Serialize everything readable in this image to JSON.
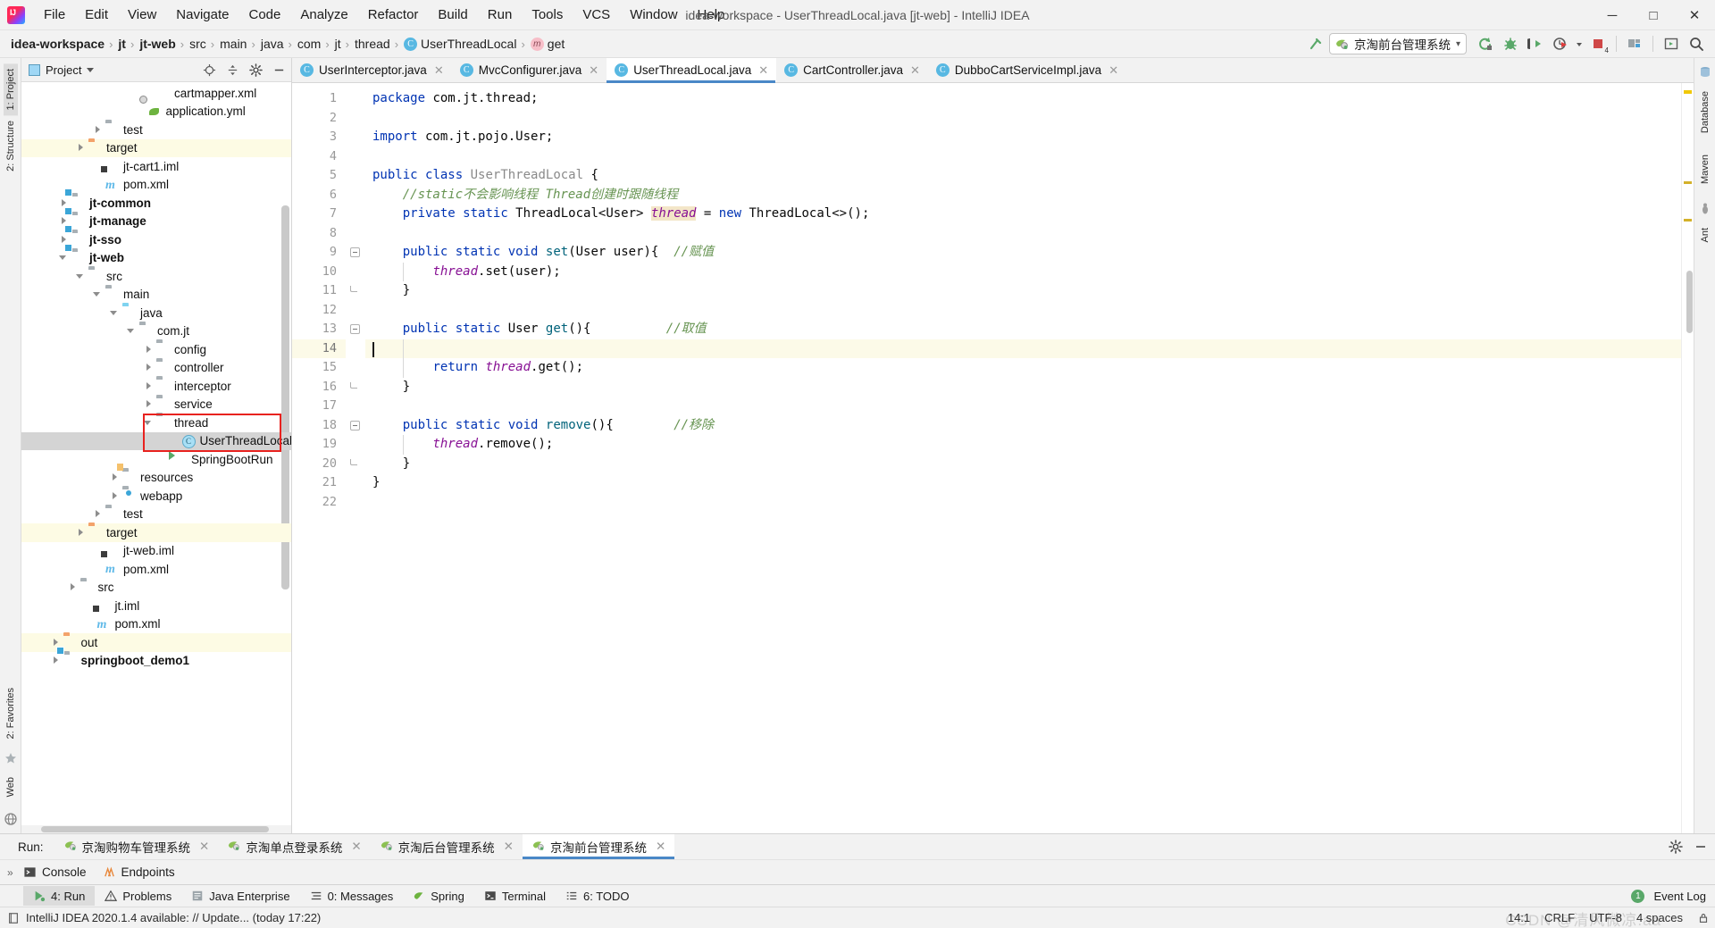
{
  "window": {
    "title": "idea-workspace - UserThreadLocal.java [jt-web] - IntelliJ IDEA",
    "minimize": "─",
    "maximize": "□",
    "close": "✕"
  },
  "menu": {
    "items": [
      "File",
      "Edit",
      "View",
      "Navigate",
      "Code",
      "Analyze",
      "Refactor",
      "Build",
      "Run",
      "Tools",
      "VCS",
      "Window",
      "Help"
    ]
  },
  "breadcrumb": {
    "items": [
      {
        "label": "idea-workspace",
        "bold": true,
        "icon": "none"
      },
      {
        "label": "jt",
        "bold": true,
        "icon": "none"
      },
      {
        "label": "jt-web",
        "bold": true,
        "icon": "none"
      },
      {
        "label": "src",
        "bold": false,
        "icon": "none"
      },
      {
        "label": "main",
        "bold": false,
        "icon": "none"
      },
      {
        "label": "java",
        "bold": false,
        "icon": "none"
      },
      {
        "label": "com",
        "bold": false,
        "icon": "none"
      },
      {
        "label": "jt",
        "bold": false,
        "icon": "none"
      },
      {
        "label": "thread",
        "bold": false,
        "icon": "none"
      },
      {
        "label": "UserThreadLocal",
        "bold": false,
        "icon": "class"
      },
      {
        "label": "get",
        "bold": false,
        "icon": "method"
      }
    ],
    "separator": "›"
  },
  "toolbar": {
    "run_config": "京淘前台管理系统",
    "run_config_caret": "▾",
    "buttons": [
      "rerun-icon",
      "debug-icon",
      "run-with-coverage-icon",
      "profiler-icon",
      "stop-icon",
      "project-structure-icon",
      "terminal-icon",
      "search-everywhere-icon"
    ],
    "stop_badge": "4"
  },
  "project_panel": {
    "title": "Project",
    "caret": "▾",
    "header_icons": [
      "locate-icon",
      "collapse-all-icon",
      "settings-icon",
      "hide-icon"
    ]
  },
  "tree": {
    "items": [
      {
        "label": "cartmapper.xml",
        "indent": 7,
        "arrow": "none",
        "icon": "xml",
        "state": "none"
      },
      {
        "label": "application.yml",
        "indent": 6.5,
        "arrow": "none",
        "icon": "yml",
        "state": "none"
      },
      {
        "label": "test",
        "indent": 4,
        "arrow": "collapsed",
        "icon": "folder-gray",
        "state": "none"
      },
      {
        "label": "target",
        "indent": 3,
        "arrow": "collapsed",
        "icon": "folder-orange",
        "state": "yellow"
      },
      {
        "label": "jt-cart1.iml",
        "indent": 4,
        "arrow": "none",
        "icon": "iml",
        "state": "none"
      },
      {
        "label": "pom.xml",
        "indent": 4,
        "arrow": "none",
        "icon": "maven",
        "state": "none"
      },
      {
        "label": "jt-common",
        "indent": 2,
        "arrow": "collapsed",
        "icon": "module",
        "state": "none",
        "bold": true
      },
      {
        "label": "jt-manage",
        "indent": 2,
        "arrow": "collapsed",
        "icon": "module",
        "state": "none",
        "bold": true
      },
      {
        "label": "jt-sso",
        "indent": 2,
        "arrow": "collapsed",
        "icon": "module",
        "state": "none",
        "bold": true
      },
      {
        "label": "jt-web",
        "indent": 2,
        "arrow": "expanded",
        "icon": "module",
        "state": "none",
        "bold": true
      },
      {
        "label": "src",
        "indent": 3,
        "arrow": "expanded",
        "icon": "folder-gray",
        "state": "none"
      },
      {
        "label": "main",
        "indent": 4,
        "arrow": "expanded",
        "icon": "folder-gray",
        "state": "none"
      },
      {
        "label": "java",
        "indent": 5,
        "arrow": "expanded",
        "icon": "folder-blue",
        "state": "none"
      },
      {
        "label": "com.jt",
        "indent": 6,
        "arrow": "expanded",
        "icon": "package",
        "state": "none"
      },
      {
        "label": "config",
        "indent": 7,
        "arrow": "collapsed",
        "icon": "package",
        "state": "none"
      },
      {
        "label": "controller",
        "indent": 7,
        "arrow": "collapsed",
        "icon": "package",
        "state": "none"
      },
      {
        "label": "interceptor",
        "indent": 7,
        "arrow": "collapsed",
        "icon": "package",
        "state": "none"
      },
      {
        "label": "service",
        "indent": 7,
        "arrow": "collapsed",
        "icon": "package",
        "state": "none"
      },
      {
        "label": "thread",
        "indent": 7,
        "arrow": "expanded",
        "icon": "package",
        "state": "none"
      },
      {
        "label": "UserThreadLocal",
        "indent": 8.5,
        "arrow": "none",
        "icon": "class",
        "state": "selected"
      },
      {
        "label": "SpringBootRun",
        "indent": 8,
        "arrow": "none",
        "icon": "springrun",
        "state": "none"
      },
      {
        "label": "resources",
        "indent": 5,
        "arrow": "collapsed",
        "icon": "resources",
        "state": "none"
      },
      {
        "label": "webapp",
        "indent": 5,
        "arrow": "collapsed",
        "icon": "webapp",
        "state": "none"
      },
      {
        "label": "test",
        "indent": 4,
        "arrow": "collapsed",
        "icon": "folder-gray",
        "state": "none"
      },
      {
        "label": "target",
        "indent": 3,
        "arrow": "collapsed",
        "icon": "folder-orange",
        "state": "yellow"
      },
      {
        "label": "jt-web.iml",
        "indent": 4,
        "arrow": "none",
        "icon": "iml",
        "state": "none"
      },
      {
        "label": "pom.xml",
        "indent": 4,
        "arrow": "none",
        "icon": "maven",
        "state": "none"
      },
      {
        "label": "src",
        "indent": 2.5,
        "arrow": "collapsed",
        "icon": "folder-gray",
        "state": "none"
      },
      {
        "label": "jt.iml",
        "indent": 3.5,
        "arrow": "none",
        "icon": "iml",
        "state": "none"
      },
      {
        "label": "pom.xml",
        "indent": 3.5,
        "arrow": "none",
        "icon": "maven",
        "state": "none"
      },
      {
        "label": "out",
        "indent": 1.5,
        "arrow": "collapsed",
        "icon": "folder-orange",
        "state": "yellow"
      },
      {
        "label": "springboot_demo1",
        "indent": 1.5,
        "arrow": "collapsed",
        "icon": "module",
        "state": "none",
        "bold": true
      }
    ]
  },
  "editor_tabs": [
    {
      "label": "UserInterceptor.java",
      "active": false,
      "close": "✕"
    },
    {
      "label": "MvcConfigurer.java",
      "active": false,
      "close": "✕"
    },
    {
      "label": "UserThreadLocal.java",
      "active": true,
      "close": "✕"
    },
    {
      "label": "CartController.java",
      "active": false,
      "close": "✕"
    },
    {
      "label": "DubboCartServiceImpl.java",
      "active": false,
      "close": "✕"
    }
  ],
  "editor": {
    "language": "java",
    "current_line": 14,
    "line_count": 22,
    "lines": [
      {
        "n": 1,
        "tokens": [
          {
            "t": "kw",
            "v": "package"
          },
          {
            "t": "pln",
            "v": " com.jt.thread;"
          }
        ]
      },
      {
        "n": 2,
        "tokens": []
      },
      {
        "n": 3,
        "tokens": [
          {
            "t": "kw",
            "v": "import"
          },
          {
            "t": "pln",
            "v": " com.jt.pojo.User;"
          }
        ]
      },
      {
        "n": 4,
        "tokens": []
      },
      {
        "n": 5,
        "tokens": [
          {
            "t": "kw",
            "v": "public"
          },
          {
            "t": "pln",
            "v": " "
          },
          {
            "t": "kw",
            "v": "class"
          },
          {
            "t": "pln",
            "v": " "
          },
          {
            "t": "cls",
            "v": "UserThreadLocal"
          },
          {
            "t": "pln",
            "v": " {"
          }
        ]
      },
      {
        "n": 6,
        "tokens": [
          {
            "t": "pln",
            "v": "    "
          },
          {
            "t": "cmt",
            "v": "//static不会影响线程 Thread创建时跟随线程"
          }
        ]
      },
      {
        "n": 7,
        "tokens": [
          {
            "t": "pln",
            "v": "    "
          },
          {
            "t": "kw",
            "v": "private"
          },
          {
            "t": "pln",
            "v": " "
          },
          {
            "t": "kw",
            "v": "static"
          },
          {
            "t": "pln",
            "v": " ThreadLocal<User> "
          },
          {
            "t": "fld-hl",
            "v": "thread"
          },
          {
            "t": "pln",
            "v": " = "
          },
          {
            "t": "kw",
            "v": "new"
          },
          {
            "t": "pln",
            "v": " ThreadLocal<>();"
          }
        ]
      },
      {
        "n": 8,
        "tokens": []
      },
      {
        "n": 9,
        "tokens": [
          {
            "t": "pln",
            "v": "    "
          },
          {
            "t": "kw",
            "v": "public"
          },
          {
            "t": "pln",
            "v": " "
          },
          {
            "t": "kw",
            "v": "static"
          },
          {
            "t": "pln",
            "v": " "
          },
          {
            "t": "kw",
            "v": "void"
          },
          {
            "t": "pln",
            "v": " "
          },
          {
            "t": "fn",
            "v": "set"
          },
          {
            "t": "pln",
            "v": "(User user){  "
          },
          {
            "t": "cmt",
            "v": "//赋值"
          }
        ]
      },
      {
        "n": 10,
        "tokens": [
          {
            "t": "pln",
            "v": "        "
          },
          {
            "t": "fld",
            "v": "thread"
          },
          {
            "t": "pln",
            "v": ".set(user);"
          }
        ]
      },
      {
        "n": 11,
        "tokens": [
          {
            "t": "pln",
            "v": "    }"
          }
        ]
      },
      {
        "n": 12,
        "tokens": []
      },
      {
        "n": 13,
        "tokens": [
          {
            "t": "pln",
            "v": "    "
          },
          {
            "t": "kw",
            "v": "public"
          },
          {
            "t": "pln",
            "v": " "
          },
          {
            "t": "kw",
            "v": "static"
          },
          {
            "t": "pln",
            "v": " User "
          },
          {
            "t": "fn",
            "v": "get"
          },
          {
            "t": "pln",
            "v": "(){          "
          },
          {
            "t": "cmt",
            "v": "//取值"
          }
        ]
      },
      {
        "n": 14,
        "tokens": []
      },
      {
        "n": 15,
        "tokens": [
          {
            "t": "pln",
            "v": "        "
          },
          {
            "t": "kw",
            "v": "return"
          },
          {
            "t": "pln",
            "v": " "
          },
          {
            "t": "fld",
            "v": "thread"
          },
          {
            "t": "pln",
            "v": ".get();"
          }
        ]
      },
      {
        "n": 16,
        "tokens": [
          {
            "t": "pln",
            "v": "    }"
          }
        ]
      },
      {
        "n": 17,
        "tokens": []
      },
      {
        "n": 18,
        "tokens": [
          {
            "t": "pln",
            "v": "    "
          },
          {
            "t": "kw",
            "v": "public"
          },
          {
            "t": "pln",
            "v": " "
          },
          {
            "t": "kw",
            "v": "static"
          },
          {
            "t": "pln",
            "v": " "
          },
          {
            "t": "kw",
            "v": "void"
          },
          {
            "t": "pln",
            "v": " "
          },
          {
            "t": "fn",
            "v": "remove"
          },
          {
            "t": "pln",
            "v": "(){        "
          },
          {
            "t": "cmt",
            "v": "//移除"
          }
        ]
      },
      {
        "n": 19,
        "tokens": [
          {
            "t": "pln",
            "v": "        "
          },
          {
            "t": "fld",
            "v": "thread"
          },
          {
            "t": "pln",
            "v": ".remove();"
          }
        ]
      },
      {
        "n": 20,
        "tokens": [
          {
            "t": "pln",
            "v": "    }"
          }
        ]
      },
      {
        "n": 21,
        "tokens": [
          {
            "t": "pln",
            "v": "}"
          }
        ]
      },
      {
        "n": 22,
        "tokens": []
      }
    ]
  },
  "right_strip": {
    "items": [
      "Database",
      "Maven",
      "Ant"
    ]
  },
  "left_strip": {
    "items": [
      "1: Project",
      "2: Structure",
      "2: Favorites",
      "Web"
    ]
  },
  "run_window": {
    "label": "Run:",
    "tabs": [
      {
        "label": "京淘购物车管理系统",
        "active": false,
        "close": "✕"
      },
      {
        "label": "京淘单点登录系统",
        "active": false,
        "close": "✕"
      },
      {
        "label": "京淘后台管理系统",
        "active": false,
        "close": "✕"
      },
      {
        "label": "京淘前台管理系统",
        "active": true,
        "close": "✕"
      }
    ],
    "sub_tabs": [
      {
        "label": "Console",
        "icon": "console-icon"
      },
      {
        "label": "Endpoints",
        "icon": "endpoints-icon"
      }
    ],
    "expand_chevron": "»",
    "settings_icon": "gear-icon",
    "hide_icon": "hide-icon"
  },
  "tool_tabs": {
    "items": [
      {
        "label": "4: Run",
        "accel": "4",
        "active": true,
        "icon": "run-icon"
      },
      {
        "label": "Problems",
        "accel": "",
        "active": false,
        "icon": "warning-icon"
      },
      {
        "label": "Java Enterprise",
        "accel": "",
        "active": false,
        "icon": "java-ee-icon"
      },
      {
        "label": "0: Messages",
        "accel": "0",
        "active": false,
        "icon": "messages-icon"
      },
      {
        "label": "Spring",
        "accel": "",
        "active": false,
        "icon": "spring-icon"
      },
      {
        "label": "Terminal",
        "accel": "",
        "active": false,
        "icon": "terminal-icon"
      },
      {
        "label": "6: TODO",
        "accel": "6",
        "active": false,
        "icon": "todo-icon"
      }
    ],
    "event_log": "Event Log",
    "event_log_count": "1"
  },
  "statusbar": {
    "message": "IntelliJ IDEA 2020.1.4 available: // Update... (today 17:22)",
    "caret_position": "14:1",
    "line_separator": "CRLF",
    "encoding": "UTF-8",
    "indent": "4 spaces",
    "lock_icon": "lock-icon",
    "watermark": "CSDN @清风微凉.aa"
  },
  "colors": {
    "accent": "#4a88c7",
    "keyword": "#0033b3",
    "comment": "#679452",
    "field": "#871094",
    "method": "#00627a",
    "highlight_box": "#e8221f",
    "green": "#59a869",
    "yellow_row": "#fdfbe4"
  }
}
